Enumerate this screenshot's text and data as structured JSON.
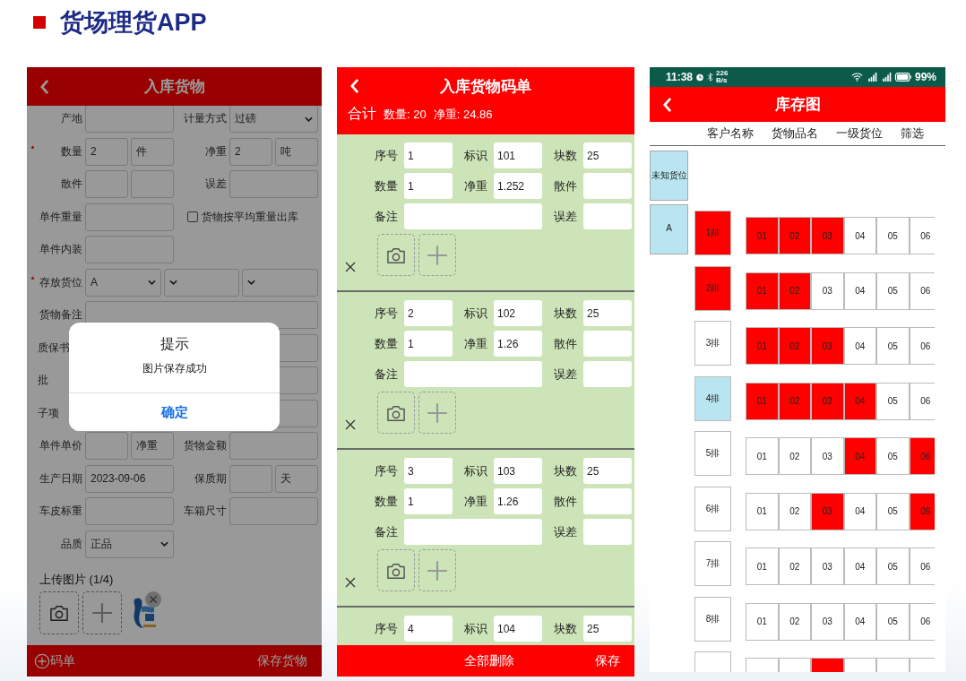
{
  "slide": {
    "title": "货场理货APP"
  },
  "form_screen": {
    "title": "入库货物",
    "rows": [
      {
        "left": [
          {
            "kind": "label",
            "text": "产地"
          },
          {
            "kind": "input-wide"
          }
        ],
        "right": [
          {
            "kind": "label",
            "text": "计量方式"
          },
          {
            "kind": "select-wide",
            "value": "过磅"
          }
        ]
      },
      {
        "left": [
          {
            "kind": "label",
            "text": "数量",
            "required": true
          },
          {
            "kind": "input",
            "value": "2"
          },
          {
            "kind": "input",
            "value": "件"
          }
        ],
        "right": [
          {
            "kind": "label",
            "text": "净重"
          },
          {
            "kind": "input",
            "value": "2"
          },
          {
            "kind": "input",
            "value": "吨"
          }
        ]
      },
      {
        "left": [
          {
            "kind": "label",
            "text": "散件"
          },
          {
            "kind": "input"
          },
          {
            "kind": "input"
          }
        ],
        "right": [
          {
            "kind": "label",
            "text": "误差"
          },
          {
            "kind": "input-wide"
          }
        ]
      },
      {
        "left": [
          {
            "kind": "label",
            "text": "单件重量"
          },
          {
            "kind": "input-wide"
          }
        ],
        "right": [
          {
            "kind": "checkbox",
            "text": "货物按平均重量出库",
            "checked": false
          }
        ]
      },
      {
        "left": [
          {
            "kind": "label",
            "text": "单件内装"
          },
          {
            "kind": "input-wide"
          }
        ]
      },
      {
        "left": [
          {
            "kind": "label",
            "text": "存放货位",
            "required": true
          },
          {
            "kind": "select-group",
            "selects": [
              {
                "kind": "filled",
                "value": "A"
              },
              {
                "kind": "blank"
              },
              {
                "kind": "blank"
              }
            ]
          }
        ]
      },
      {
        "left": [
          {
            "kind": "label",
            "text": "货物备注"
          },
          {
            "kind": "input-full"
          }
        ]
      },
      {
        "left": [
          {
            "kind": "label-cut",
            "text": "质保书"
          }
        ],
        "right": [
          {
            "kind": "input-end"
          }
        ]
      },
      {
        "left": [
          {
            "kind": "label-cut",
            "text": "批"
          }
        ],
        "right": [
          {
            "kind": "input-end"
          }
        ]
      },
      {
        "left": [
          {
            "kind": "label-cut",
            "text": "子项"
          }
        ],
        "right": [
          {
            "kind": "input-end"
          }
        ]
      },
      {
        "left": [
          {
            "kind": "label",
            "text": "单件单价"
          },
          {
            "kind": "input"
          },
          {
            "kind": "input",
            "value": "净重"
          }
        ],
        "right": [
          {
            "kind": "label",
            "text": "货物金额"
          },
          {
            "kind": "input-wide"
          }
        ]
      },
      {
        "left": [
          {
            "kind": "label",
            "text": "生产日期"
          },
          {
            "kind": "input-wide",
            "value": "2023-09-06"
          }
        ],
        "right": [
          {
            "kind": "label",
            "text": "保质期"
          },
          {
            "kind": "input"
          },
          {
            "kind": "input",
            "value": "天"
          }
        ]
      },
      {
        "left": [
          {
            "kind": "label",
            "text": "车皮标重"
          },
          {
            "kind": "input-wide"
          }
        ],
        "right": [
          {
            "kind": "label",
            "text": "车箱尺寸"
          },
          {
            "kind": "input-wide"
          }
        ]
      },
      {
        "left": [
          {
            "kind": "label",
            "text": "品质"
          },
          {
            "kind": "select-wide",
            "value": "正品"
          }
        ]
      }
    ],
    "upload": {
      "label": "上传图片 (1/4)"
    },
    "footer": {
      "left": "码单",
      "right": "保存货物"
    },
    "dialog": {
      "title": "提示",
      "message": "图片保存成功",
      "button": "确定"
    }
  },
  "list_screen": {
    "title": "入库货物码单",
    "totals": {
      "label": "合计",
      "quantity": "数量: 20",
      "weight": "净重: 24.86"
    },
    "cards": [
      {
        "photo_row": true,
        "fields": [
          {
            "kind": "field",
            "label": "序号",
            "value": "1"
          },
          {
            "kind": "field",
            "label": "标识",
            "value": "101"
          },
          {
            "kind": "field",
            "label": "块数",
            "value": "25"
          },
          {
            "kind": "field",
            "label": "数量",
            "value": "1"
          },
          {
            "kind": "field",
            "label": "净重",
            "value": "1.252"
          },
          {
            "kind": "field",
            "label": "散件"
          },
          {
            "kind": "wide",
            "label": "备注"
          },
          {
            "kind": "field",
            "label": "误差"
          }
        ]
      },
      {
        "photo_row": true,
        "fields": [
          {
            "kind": "field",
            "label": "序号",
            "value": "2"
          },
          {
            "kind": "field",
            "label": "标识",
            "value": "102"
          },
          {
            "kind": "field",
            "label": "块数",
            "value": "25"
          },
          {
            "kind": "field",
            "label": "数量",
            "value": "1"
          },
          {
            "kind": "field",
            "label": "净重",
            "value": "1.26"
          },
          {
            "kind": "field",
            "label": "散件"
          },
          {
            "kind": "wide",
            "label": "备注"
          },
          {
            "kind": "field",
            "label": "误差"
          }
        ]
      },
      {
        "photo_row": true,
        "fields": [
          {
            "kind": "field",
            "label": "序号",
            "value": "3"
          },
          {
            "kind": "field",
            "label": "标识",
            "value": "103"
          },
          {
            "kind": "field",
            "label": "块数",
            "value": "25"
          },
          {
            "kind": "field",
            "label": "数量",
            "value": "1"
          },
          {
            "kind": "field",
            "label": "净重",
            "value": "1.26"
          },
          {
            "kind": "field",
            "label": "散件"
          },
          {
            "kind": "wide",
            "label": "备注"
          },
          {
            "kind": "field",
            "label": "误差"
          }
        ]
      },
      {
        "photo_row": false,
        "fields": [
          {
            "kind": "field",
            "label": "序号",
            "value": "4"
          },
          {
            "kind": "field",
            "label": "标识",
            "value": "104"
          },
          {
            "kind": "field",
            "label": "块数",
            "value": "25"
          }
        ]
      }
    ],
    "footer": {
      "delete_all": "全部删除",
      "save": "保存"
    }
  },
  "map_screen": {
    "status_bar": {
      "time": "11:38",
      "speed": "226",
      "speed_unit": "B/s",
      "battery": "99%"
    },
    "title": "库存图",
    "filters": [
      "客户名称",
      "货物品名",
      "一级货位",
      "筛选"
    ],
    "zones": [
      "未知货位",
      "A"
    ],
    "rows": [
      {
        "label": "1排",
        "full": true,
        "selected": false,
        "slots": [
          {
            "number": "01",
            "occupied": true
          },
          {
            "number": "02",
            "occupied": true
          },
          {
            "number": "03",
            "occupied": true
          },
          {
            "number": "04",
            "occupied": false
          },
          {
            "number": "05",
            "occupied": false
          },
          {
            "number": "06",
            "occupied": false
          }
        ]
      },
      {
        "label": "2排",
        "full": true,
        "selected": false,
        "slots": [
          {
            "number": "01",
            "occupied": true
          },
          {
            "number": "02",
            "occupied": true
          },
          {
            "number": "03",
            "occupied": false
          },
          {
            "number": "04",
            "occupied": false
          },
          {
            "number": "05",
            "occupied": false
          },
          {
            "number": "06",
            "occupied": false
          }
        ]
      },
      {
        "label": "3排",
        "full": false,
        "selected": false,
        "slots": [
          {
            "number": "01",
            "occupied": true
          },
          {
            "number": "02",
            "occupied": true
          },
          {
            "number": "03",
            "occupied": true
          },
          {
            "number": "04",
            "occupied": false
          },
          {
            "number": "05",
            "occupied": false
          },
          {
            "number": "06",
            "occupied": false
          }
        ]
      },
      {
        "label": "4排",
        "full": false,
        "selected": true,
        "slots": [
          {
            "number": "01",
            "occupied": true
          },
          {
            "number": "02",
            "occupied": true
          },
          {
            "number": "03",
            "occupied": true
          },
          {
            "number": "04",
            "occupied": true
          },
          {
            "number": "05",
            "occupied": false
          },
          {
            "number": "06",
            "occupied": false
          }
        ]
      },
      {
        "label": "5排",
        "full": false,
        "selected": false,
        "slots": [
          {
            "number": "01",
            "occupied": false
          },
          {
            "number": "02",
            "occupied": false
          },
          {
            "number": "03",
            "occupied": false
          },
          {
            "number": "04",
            "occupied": true
          },
          {
            "number": "05",
            "occupied": false
          },
          {
            "number": "06",
            "occupied": true
          }
        ]
      },
      {
        "label": "6排",
        "full": false,
        "selected": false,
        "slots": [
          {
            "number": "01",
            "occupied": false
          },
          {
            "number": "02",
            "occupied": false
          },
          {
            "number": "03",
            "occupied": true
          },
          {
            "number": "04",
            "occupied": false
          },
          {
            "number": "05",
            "occupied": false
          },
          {
            "number": "06",
            "occupied": true
          }
        ]
      },
      {
        "label": "7排",
        "full": false,
        "selected": false,
        "slots": [
          {
            "number": "01",
            "occupied": false
          },
          {
            "number": "02",
            "occupied": false
          },
          {
            "number": "03",
            "occupied": false
          },
          {
            "number": "04",
            "occupied": false
          },
          {
            "number": "05",
            "occupied": false
          },
          {
            "number": "06",
            "occupied": false
          }
        ]
      },
      {
        "label": "8排",
        "full": false,
        "selected": false,
        "slots": [
          {
            "number": "01",
            "occupied": false
          },
          {
            "number": "02",
            "occupied": false
          },
          {
            "number": "03",
            "occupied": false
          },
          {
            "number": "04",
            "occupied": false
          },
          {
            "number": "05",
            "occupied": false
          },
          {
            "number": "06",
            "occupied": false
          }
        ]
      },
      {
        "full": false,
        "selected": false,
        "slots": [
          {
            "occupied": false
          },
          {
            "occupied": false
          },
          {
            "occupied": true
          },
          {
            "occupied": false
          },
          {
            "occupied": false
          },
          {
            "occupied": false
          }
        ]
      }
    ]
  }
}
